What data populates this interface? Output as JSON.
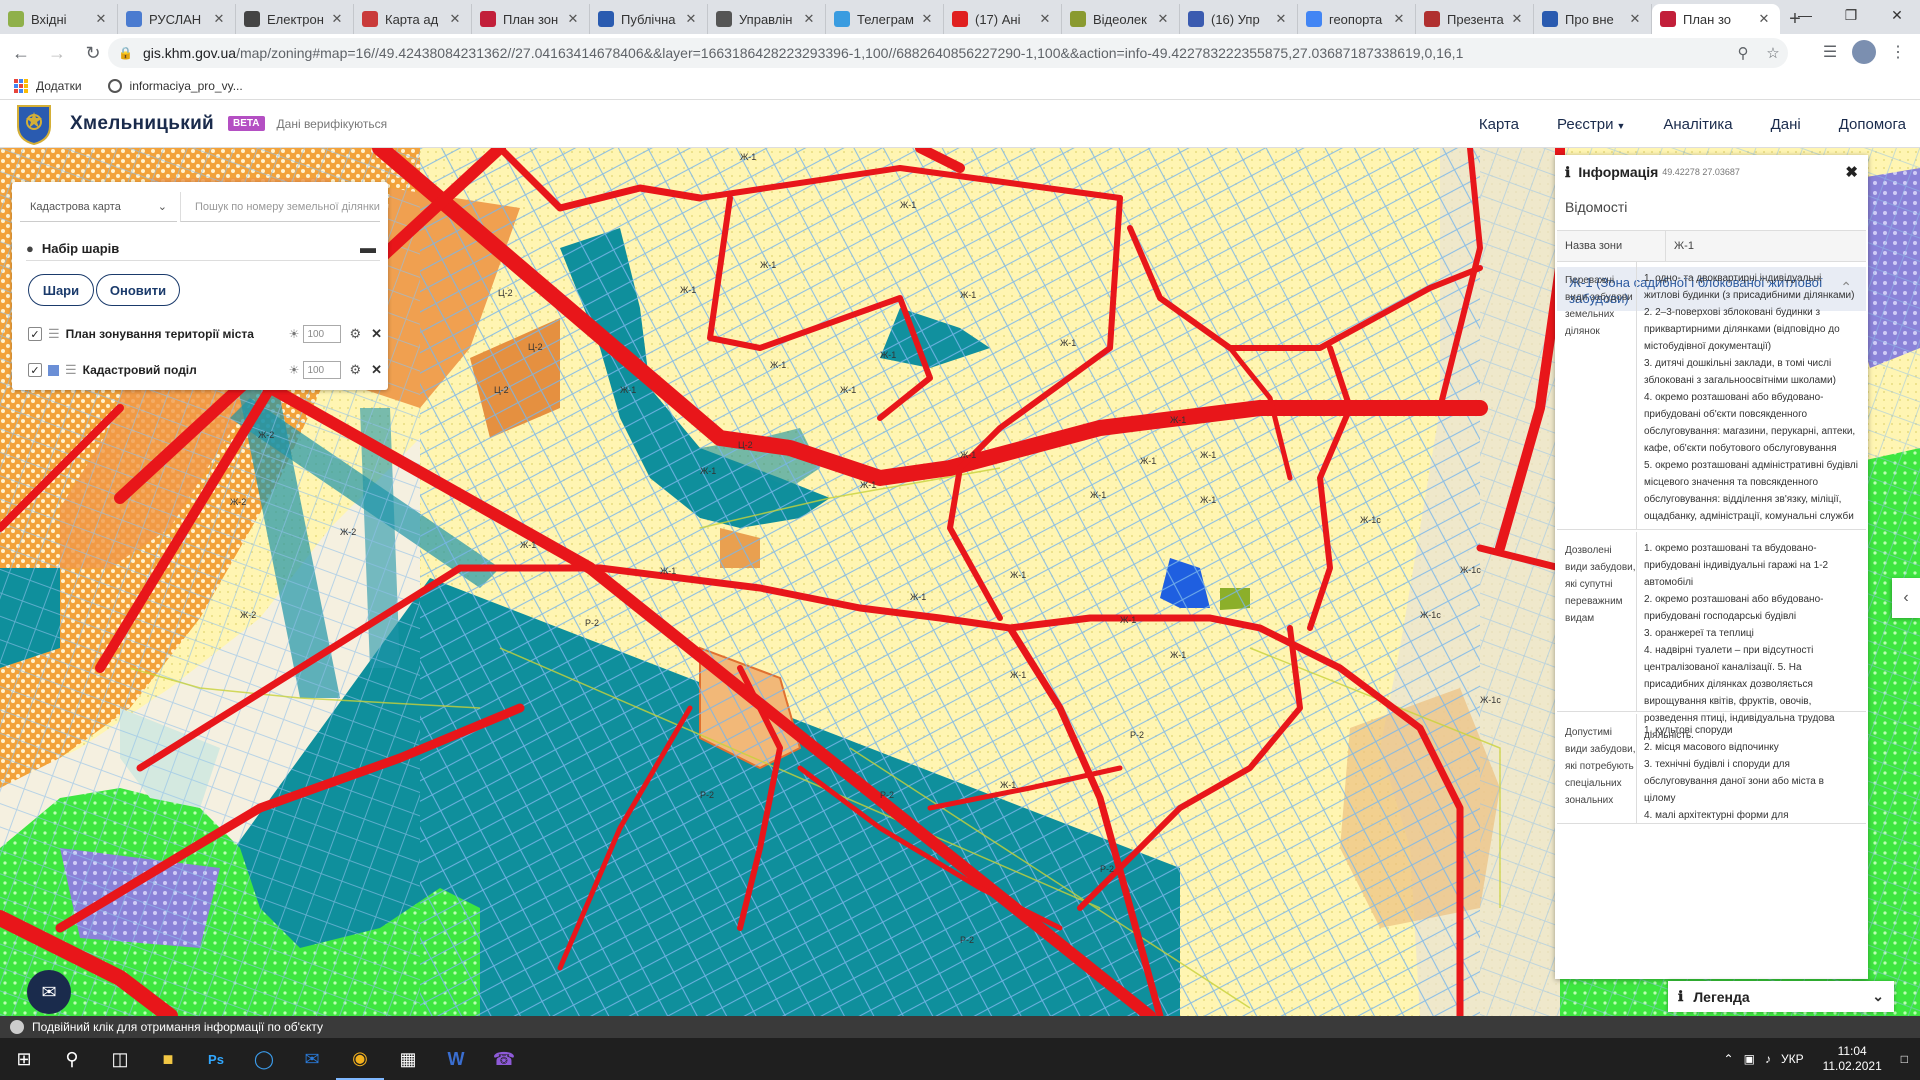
{
  "browser": {
    "tabs": [
      {
        "title": "Вхідні",
        "color": "#8fb04a"
      },
      {
        "title": "РУСЛАН",
        "color": "#4a7bd0"
      },
      {
        "title": "Електрон",
        "color": "#444444"
      },
      {
        "title": "Карта ад",
        "color": "#c93a3a"
      },
      {
        "title": "План зон",
        "color": "#c21f3a"
      },
      {
        "title": "Публічна",
        "color": "#2a5bb0"
      },
      {
        "title": "Управлін",
        "color": "#555555"
      },
      {
        "title": "Телеграм",
        "color": "#3a9ce0"
      },
      {
        "title": "(17) Ані",
        "color": "#e02020"
      },
      {
        "title": "Відеолек",
        "color": "#8a9a30"
      },
      {
        "title": "(16) Упр",
        "color": "#3b5bb0"
      },
      {
        "title": "геопорта",
        "color": "#4285f4"
      },
      {
        "title": "Презента",
        "color": "#b03030"
      },
      {
        "title": "Про вне",
        "color": "#2a5bb0"
      },
      {
        "title": "План зо",
        "color": "#c21f3a",
        "active": true
      }
    ],
    "url_domain": "gis.khm.gov.ua",
    "url_path": "/map/zoning#map=16//49.42438084231362//27.04163414678406&&layer=1663186428223293396-1,100//6882640856227290-1,100&&action=info-49.422783222355875,27.03687187338619,0,16,1",
    "bookmarks": [
      "Додатки",
      "informaciya_pro_vy..."
    ]
  },
  "app": {
    "title": "Хмельницький",
    "beta": "BETA",
    "verification": "Дані верифікуються",
    "menu": [
      "Карта",
      "Реєстри",
      "Аналітика",
      "Дані",
      "Допомога"
    ]
  },
  "layers": {
    "select_value": "Кадастрова карта",
    "search_placeholder": "Пошук по номеру земельної ділянки",
    "header": "Набір шарів",
    "btn_layers": "Шари",
    "btn_refresh": "Оновити",
    "items": [
      {
        "name": "План зонування території міста",
        "opacity": "100",
        "checked": true
      },
      {
        "name": "Кадастровий поділ",
        "opacity": "100",
        "checked": true
      }
    ]
  },
  "map": {
    "zone_labels": [
      "Ж-1",
      "Ж-1",
      "Ж-1",
      "Ж-1",
      "Ж-1",
      "Ж-1",
      "Ж-1",
      "Ж-1",
      "Ж-1",
      "Ж-1",
      "Ж-1",
      "Ж-1",
      "Ж-1",
      "Ж-1",
      "Ж-1",
      "Ж-1",
      "Ж-1",
      "Ж-1",
      "Ж-1",
      "Ж-1",
      "Ж-1",
      "Ж-1",
      "Ж-1",
      "Ж-1",
      "Ж-1с",
      "Ж-1с",
      "Ж-1с",
      "Ж-1с",
      "Ж-2",
      "Ж-2",
      "Ж-2",
      "Ж-2",
      "Ц-2",
      "Ц-2",
      "Ц-2",
      "Ц-2",
      "Ц-2",
      "Р-2",
      "Р-2",
      "Р-2",
      "Р-2",
      "Р-2",
      "Р-2",
      "Ж-1",
      "Ж-1"
    ],
    "colors": {
      "residential": "#fff6b0",
      "road": "#e8161a",
      "water": "#0e8a9a",
      "green": "#34e63a",
      "commercial": "#f0a040",
      "parcel": "#6aa8e8"
    }
  },
  "info": {
    "title": "Інформація",
    "coords": "49.42278 27.03687",
    "section": "Відомості",
    "zone_key": "Назва зони",
    "zone_value": "Ж-1",
    "zone_title": "Ж-1 (Зона садибної і блокованої житлової забудови)",
    "blocks": [
      {
        "key": "Переважні види забудови земельних ділянок",
        "lines": [
          "1. одно- та двоквартирні індивідуальні житлові будинки (з присадибними ділянками)",
          "2. 2–3-поверхові зблоковані будинки з приквартирними ділянками (відповідно до містобудівної документації)",
          "3. дитячі дошкільні заклади, в томі числі зблоковані з загальноосвітніми школами)",
          "4. окремо розташовані або вбудовано-прибудовані об'єкти повсякденного обслуговування: магазини, перукарні, аптеки, кафе, об'єкти побутового обслуговування",
          "5. окремо розташовані адміністративні будівлі місцевого значення та повсякденного обслуговування: відділення зв'язку, міліції, ощадбанку, адміністрації, комунальні служби"
        ]
      },
      {
        "key": "Дозволені види забудови, які супутні переважним видам",
        "lines": [
          "1. окремо розташовані та вбудовано-прибудовані індивідуальні гаражі на 1-2 автомобілі",
          "2. окремо розташовані або вбудовано-прибудовані господарські будівлі",
          "3. оранжереї та теплиці",
          "4. надвірні туалети – при відсутності централізованої каналізації. 5. На присадибних ділянках дозволяється вирощування квітів, фруктів, овочів, розведення птиці, індивідуальна трудова діяльність."
        ]
      },
      {
        "key": "Допустимі види забудови, які потребують спеціальних зональних",
        "lines": [
          "1. культові споруди",
          "2. місця масового відпочинку",
          "3. технічні будівлі і споруди для обслуговування даної зони або міста в цілому",
          "4. малі архітектурні форми для"
        ]
      }
    ]
  },
  "legend": "Легенда",
  "status": "Подвійний клік для отримання інформації по об'єкту",
  "taskbar": {
    "lang": "УКР",
    "time": "11:04",
    "date": "11.02.2021"
  }
}
